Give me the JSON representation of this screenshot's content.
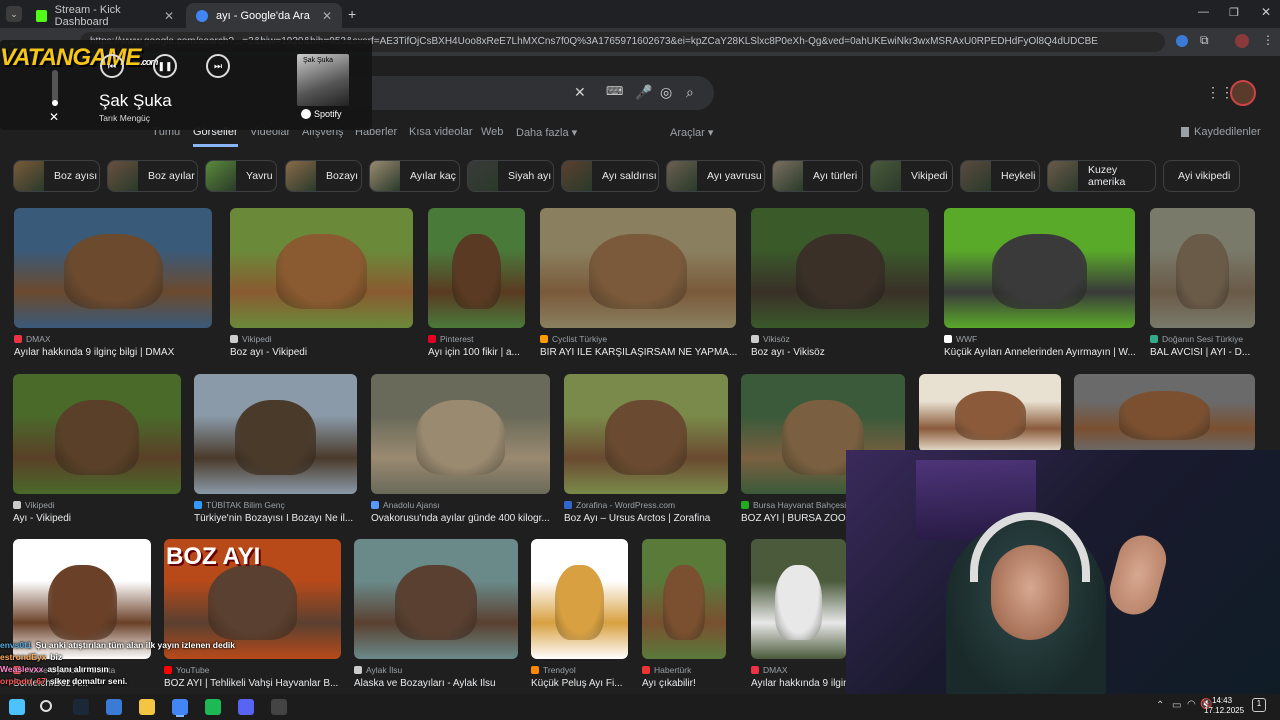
{
  "browser": {
    "tabs": [
      {
        "label": "Stream - Kick Dashboard",
        "icon": "kick-icon",
        "color": "#53fc18"
      },
      {
        "label": "ayı - Google'da Ara",
        "icon": "google-icon",
        "color": "#4285f4"
      }
    ],
    "url": "https://www.google.com/search?...=2&biw=1920&bih=953&sxsrf=AE3TifOjCsBXH4Uoo8xReE7LhMXCns7f0Q%3A1765971602673&ei=kpZCaY28KLSlxc8P0eXh-Qg&ved=0ahUKEwiNkr3wxMSRAxU0RPEDHdFyOl8Q4dUDCBE"
  },
  "google": {
    "nav_tabs": [
      "Tümü",
      "Görseller",
      "Videolar",
      "Alışveriş",
      "Haberler",
      "Kısa videolar",
      "Web",
      "Daha fazla ▾"
    ],
    "active_tab": "Görseller",
    "tools_label": "Araçlar ▾",
    "saved_label": "Kaydedilenler",
    "chips": [
      {
        "label": "Boz ayısı",
        "color": "#7a5a3a"
      },
      {
        "label": "Boz ayılar",
        "color": "#6a5040"
      },
      {
        "label": "Yavru",
        "color": "#5a8a3a"
      },
      {
        "label": "Bozayı",
        "color": "#8a6a4a"
      },
      {
        "label": "Ayılar kaç",
        "color": "#9a8a70"
      },
      {
        "label": "Siyah ayı",
        "color": "#3a3a3a"
      },
      {
        "label": "Ayı saldırısı",
        "color": "#5a4030"
      },
      {
        "label": "Ayı yavrusu",
        "color": "#6a6050"
      },
      {
        "label": "Ayı türleri",
        "color": "#7a7060"
      },
      {
        "label": "Vikipedi",
        "color": "#4a5a3a"
      },
      {
        "label": "Heykeli",
        "color": "#5a4a40"
      },
      {
        "label": "Kuzey amerika",
        "color": "#6a5a4a"
      },
      {
        "label": "Ayi vikipedi",
        "color": ""
      }
    ],
    "results": [
      {
        "source": "DMAX",
        "title": "Ayılar hakkında 9 ilginç bilgi | DMAX",
        "c1": "#6b4a2e",
        "c2": "#3a5a7a",
        "sc": "#e34"
      },
      {
        "source": "Vikipedi",
        "title": "Boz ayı - Vikipedi",
        "c1": "#8a5a30",
        "c2": "#6a8a3a",
        "sc": "#ccc"
      },
      {
        "source": "Pinterest",
        "title": "Ayı için 100 fikir | a...",
        "c1": "#5a3a22",
        "c2": "#4a7a3a",
        "sc": "#e60023"
      },
      {
        "source": "Cyclist Türkiye",
        "title": "BİR AYI İLE KARŞILAŞIRSAM NE YAPMA...",
        "c1": "#7a5a3a",
        "c2": "#8a8060",
        "sc": "#f90"
      },
      {
        "source": "Vikisöz",
        "title": "Boz ayı - Vikisöz",
        "c1": "#3a3028",
        "c2": "#3a5a2a",
        "sc": "#ccc"
      },
      {
        "source": "WWF",
        "title": "Küçük Ayıları Annelerinden Ayırmayın | W...",
        "c1": "#3a3a3a",
        "c2": "#5aaa2a",
        "sc": "#fff"
      },
      {
        "source": "Doğanın Sesi Türkiye",
        "title": "BAL AVCISI | AYI - D...",
        "c1": "#6a5a48",
        "c2": "#7a7a6a",
        "sc": "#3a8"
      },
      {
        "source": "Vikipedi",
        "title": "Ayı - Vikipedi",
        "c1": "#5a4028",
        "c2": "#4a6a2a",
        "sc": "#ccc"
      },
      {
        "source": "TÜBİTAK Bilim Genç",
        "title": "Türkiye'nin Bozayısı I Bozayı Ne il...",
        "c1": "#4a3a2a",
        "c2": "#8a9aa8",
        "sc": "#39f"
      },
      {
        "source": "Anadolu Ajansı",
        "title": "Ovakorusu'nda ayılar günde 400 kilogr...",
        "c1": "#9a8a70",
        "c2": "#6a6a5a",
        "sc": "#59f"
      },
      {
        "source": "Zorafina - WordPress.com",
        "title": "Boz Ayı – Ursus Arctos | Zorafina",
        "c1": "#6a4a30",
        "c2": "#7a8a4a",
        "sc": "#36c"
      },
      {
        "source": "Bursa Hayvanat Bahçesi",
        "title": "BOZ AYI | BURSA ZOO",
        "c1": "#7a6040",
        "c2": "#3a5a3a",
        "sc": "#2a2"
      },
      {
        "source": "",
        "title": "",
        "c1": "#8a5a3a",
        "c2": "#e8e0d0",
        "sc": ""
      },
      {
        "source": "",
        "title": "",
        "c1": "#7a5030",
        "c2": "#6a6a6a",
        "sc": ""
      },
      {
        "source": "Adore Oyuncak · Stokta",
        "title": "Schleich Boz A...",
        "c1": "#6a4028",
        "c2": "#ffffff",
        "sc": "#f66"
      },
      {
        "source": "YouTube",
        "title": "BOZ AYI | Tehlikeli Vahşi Hayvanlar B...",
        "c1": "#5a4030",
        "c2": "#b84a1a",
        "sc": "#f00"
      },
      {
        "source": "Aylak İlsu",
        "title": "Alaska ve Bozayıları - Aylak İlsu",
        "c1": "#5a4030",
        "c2": "#6a8a8a",
        "sc": "#ccc"
      },
      {
        "source": "Trendyol",
        "title": "Küçük Peluş Ayı Fi...",
        "c1": "#d8a040",
        "c2": "#ffffff",
        "sc": "#f80"
      },
      {
        "source": "Habertürk",
        "title": "Ayı çıkabilir!",
        "c1": "#7a5030",
        "c2": "#5a7a3a",
        "sc": "#e33"
      },
      {
        "source": "DMAX",
        "title": "Ayılar hakkında 9 ilgin",
        "c1": "#e8e8e8",
        "c2": "#4a5a3a",
        "sc": "#e34"
      }
    ],
    "bozayi_overlay_text": "BOZ AYI"
  },
  "overlay": {
    "logo": "VATANGAME",
    "logo_sub": ".com",
    "song": "Şak Şuka",
    "artist": "Tarık Mengüç",
    "spotify_label": "Spotify",
    "cover_text": "Şak Şuka"
  },
  "chat": [
    {
      "user": "envs0t1",
      "text": "Şu anki atıştırılan tüm alan ilk yayın izlenen dedik",
      "color": "#5ad"
    },
    {
      "user": "estrondEyx",
      "text": "biz",
      "color": "#fa5"
    },
    {
      "user": "Weaslevxx",
      "text": "aslanı alırmısın",
      "color": "#f8c"
    },
    {
      "user": "orpioon_67",
      "text": "şiker domaltır seni.",
      "color": "#f55"
    }
  ],
  "taskbar": {
    "time": "14:43",
    "date": "17.12.2025",
    "icons": [
      {
        "name": "windows-icon",
        "color": "#4cc2ff"
      },
      {
        "name": "search-icon",
        "color": ""
      },
      {
        "name": "steam-icon",
        "color": "#1b2838"
      },
      {
        "name": "store-icon",
        "color": "#3a7bd5"
      },
      {
        "name": "folder-icon",
        "color": "#f4c542"
      },
      {
        "name": "chrome-icon",
        "color": "#4285f4"
      },
      {
        "name": "spotify-icon",
        "color": "#1db954"
      },
      {
        "name": "discord-icon",
        "color": "#5865f2"
      },
      {
        "name": "obs-icon",
        "color": "#444"
      }
    ]
  }
}
